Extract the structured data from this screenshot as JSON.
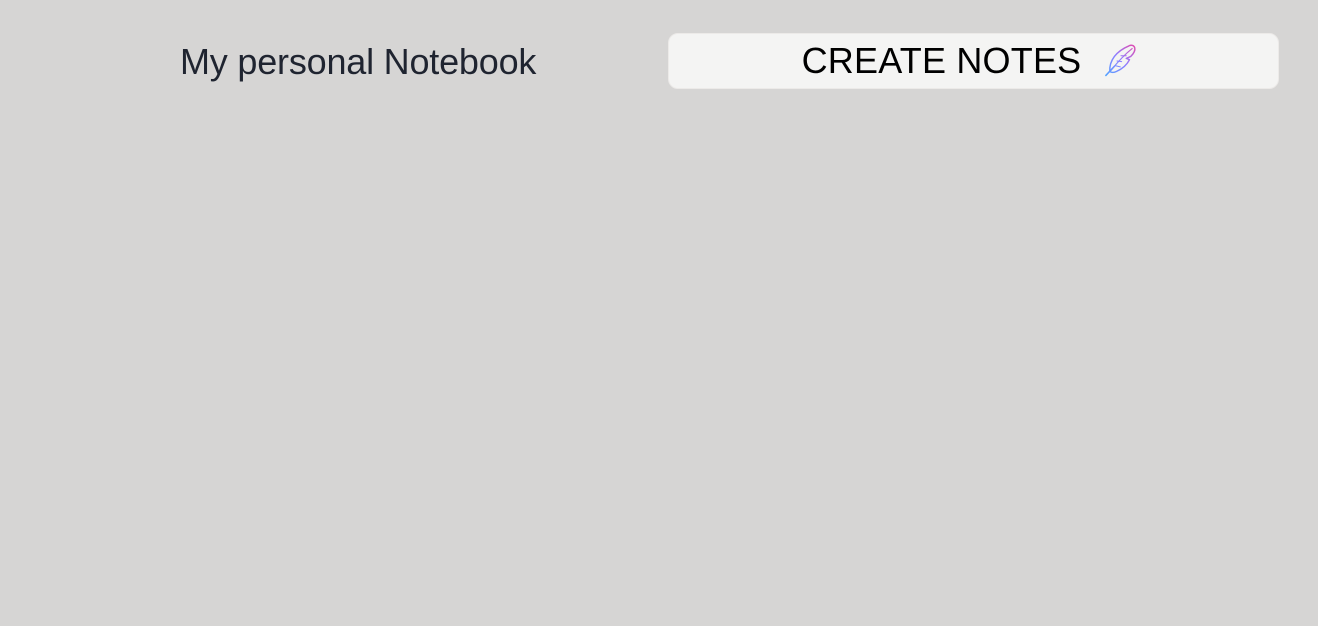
{
  "header": {
    "title": "My personal Notebook",
    "create_button": {
      "label": "CREATE NOTES",
      "icon": "feather-icon"
    }
  },
  "colors": {
    "page_background": "#d6d5d4",
    "button_background": "#f4f4f3",
    "text": "#1f2430",
    "icon_gradient_start": "#4fa6ff",
    "icon_gradient_end": "#e04bb0"
  }
}
